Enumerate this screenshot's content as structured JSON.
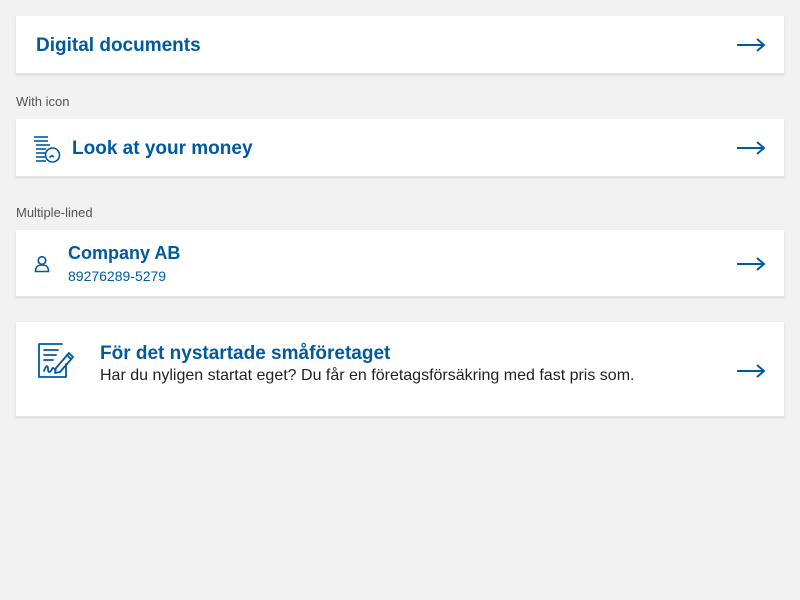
{
  "colors": {
    "accent": "#005aa0",
    "background": "#f1f1f1",
    "card": "#ffffff",
    "caption": "#555555",
    "body_text": "#222222"
  },
  "cards": [
    {
      "title": "Digital documents",
      "arrow_icon": "arrow-right-icon"
    },
    {
      "title": "Look at your money",
      "icon": "coins-icon",
      "arrow_icon": "arrow-right-icon"
    },
    {
      "title": "Company AB",
      "subtitle": "89276289-5279",
      "icon": "person-icon",
      "arrow_icon": "arrow-right-icon"
    },
    {
      "title": "För det nystartade småföretaget",
      "description": "Har du nyligen startat eget? Du får en företagsförsäkring med fast pris som.",
      "icon": "signed-document-icon",
      "arrow_icon": "arrow-right-icon"
    }
  ],
  "captions": {
    "with_icon": "With icon",
    "multiple_lined": "Multiple-lined"
  }
}
